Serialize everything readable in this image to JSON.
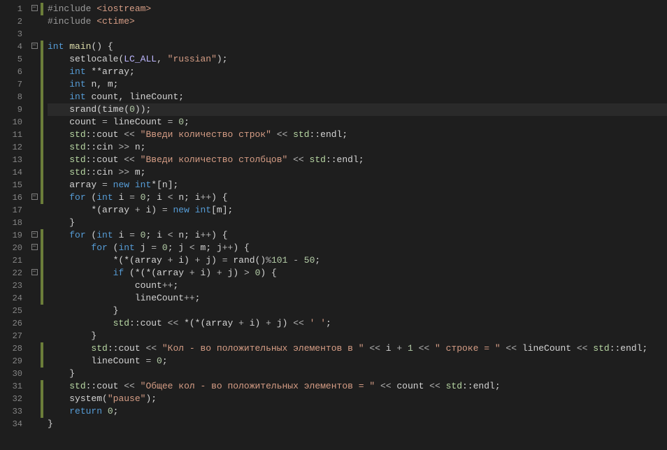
{
  "lineCount": 34,
  "foldMarkers": {
    "1": true,
    "4": true,
    "16": true,
    "19": true,
    "20": true,
    "22": true
  },
  "changedLines": [
    1,
    4,
    5,
    6,
    7,
    8,
    9,
    10,
    11,
    12,
    13,
    14,
    15,
    16,
    19,
    20,
    21,
    22,
    23,
    24,
    28,
    29,
    31,
    32,
    33
  ],
  "currentLine": 9,
  "code": [
    [
      [
        "tok-pp",
        "#include "
      ],
      [
        "tok-inc",
        "<iostream>"
      ]
    ],
    [
      [
        "tok-pp",
        "#include "
      ],
      [
        "tok-inc",
        "<ctime>"
      ]
    ],
    [],
    [
      [
        "tok-kw",
        "int"
      ],
      [
        "tok-punct",
        " "
      ],
      [
        "tok-fn",
        "main"
      ],
      [
        "tok-punct",
        "() {"
      ]
    ],
    [
      [
        "tok-punct",
        "    "
      ],
      [
        "tok-id",
        "setlocale"
      ],
      [
        "tok-punct",
        "("
      ],
      [
        "tok-macro",
        "LC_ALL"
      ],
      [
        "tok-punct",
        ", "
      ],
      [
        "tok-str",
        "\"russian\""
      ],
      [
        "tok-punct",
        ");"
      ]
    ],
    [
      [
        "tok-punct",
        "    "
      ],
      [
        "tok-kw",
        "int"
      ],
      [
        "tok-punct",
        " **"
      ],
      [
        "tok-id",
        "array"
      ],
      [
        "tok-punct",
        ";"
      ]
    ],
    [
      [
        "tok-punct",
        "    "
      ],
      [
        "tok-kw",
        "int"
      ],
      [
        "tok-punct",
        " "
      ],
      [
        "tok-id",
        "n"
      ],
      [
        "tok-punct",
        ", "
      ],
      [
        "tok-id",
        "m"
      ],
      [
        "tok-punct",
        ";"
      ]
    ],
    [
      [
        "tok-punct",
        "    "
      ],
      [
        "tok-kw",
        "int"
      ],
      [
        "tok-punct",
        " "
      ],
      [
        "tok-id",
        "count"
      ],
      [
        "tok-punct",
        ", "
      ],
      [
        "tok-id",
        "lineCount"
      ],
      [
        "tok-punct",
        ";"
      ]
    ],
    [
      [
        "tok-punct",
        "    "
      ],
      [
        "tok-id",
        "srand"
      ],
      [
        "tok-punct",
        "("
      ],
      [
        "tok-id",
        "time"
      ],
      [
        "tok-punct",
        "("
      ],
      [
        "tok-num",
        "0"
      ],
      [
        "tok-punct",
        "));"
      ]
    ],
    [
      [
        "tok-punct",
        "    "
      ],
      [
        "tok-id",
        "count"
      ],
      [
        "tok-op",
        " = "
      ],
      [
        "tok-id",
        "lineCount"
      ],
      [
        "tok-op",
        " = "
      ],
      [
        "tok-num",
        "0"
      ],
      [
        "tok-punct",
        ";"
      ]
    ],
    [
      [
        "tok-punct",
        "    "
      ],
      [
        "tok-ns",
        "std"
      ],
      [
        "tok-punct",
        "::"
      ],
      [
        "tok-id",
        "cout"
      ],
      [
        "tok-op",
        " << "
      ],
      [
        "tok-str",
        "\"Введи количество строк\""
      ],
      [
        "tok-op",
        " << "
      ],
      [
        "tok-ns",
        "std"
      ],
      [
        "tok-punct",
        "::"
      ],
      [
        "tok-id",
        "endl"
      ],
      [
        "tok-punct",
        ";"
      ]
    ],
    [
      [
        "tok-punct",
        "    "
      ],
      [
        "tok-ns",
        "std"
      ],
      [
        "tok-punct",
        "::"
      ],
      [
        "tok-id",
        "cin"
      ],
      [
        "tok-op",
        " >> "
      ],
      [
        "tok-id",
        "n"
      ],
      [
        "tok-punct",
        ";"
      ]
    ],
    [
      [
        "tok-punct",
        "    "
      ],
      [
        "tok-ns",
        "std"
      ],
      [
        "tok-punct",
        "::"
      ],
      [
        "tok-id",
        "cout"
      ],
      [
        "tok-op",
        " << "
      ],
      [
        "tok-str",
        "\"Введи количество столбцов\""
      ],
      [
        "tok-op",
        " << "
      ],
      [
        "tok-ns",
        "std"
      ],
      [
        "tok-punct",
        "::"
      ],
      [
        "tok-id",
        "endl"
      ],
      [
        "tok-punct",
        ";"
      ]
    ],
    [
      [
        "tok-punct",
        "    "
      ],
      [
        "tok-ns",
        "std"
      ],
      [
        "tok-punct",
        "::"
      ],
      [
        "tok-id",
        "cin"
      ],
      [
        "tok-op",
        " >> "
      ],
      [
        "tok-id",
        "m"
      ],
      [
        "tok-punct",
        ";"
      ]
    ],
    [
      [
        "tok-punct",
        "    "
      ],
      [
        "tok-id",
        "array"
      ],
      [
        "tok-op",
        " = "
      ],
      [
        "tok-kw",
        "new"
      ],
      [
        "tok-punct",
        " "
      ],
      [
        "tok-kw",
        "int"
      ],
      [
        "tok-punct",
        "*["
      ],
      [
        "tok-id",
        "n"
      ],
      [
        "tok-punct",
        "];"
      ]
    ],
    [
      [
        "tok-punct",
        "    "
      ],
      [
        "tok-kw",
        "for"
      ],
      [
        "tok-punct",
        " ("
      ],
      [
        "tok-kw",
        "int"
      ],
      [
        "tok-punct",
        " "
      ],
      [
        "tok-id",
        "i"
      ],
      [
        "tok-op",
        " = "
      ],
      [
        "tok-num",
        "0"
      ],
      [
        "tok-punct",
        "; "
      ],
      [
        "tok-id",
        "i"
      ],
      [
        "tok-op",
        " < "
      ],
      [
        "tok-id",
        "n"
      ],
      [
        "tok-punct",
        "; "
      ],
      [
        "tok-id",
        "i"
      ],
      [
        "tok-op",
        "++"
      ],
      [
        "tok-punct",
        ") {"
      ]
    ],
    [
      [
        "tok-punct",
        "        *("
      ],
      [
        "tok-id",
        "array"
      ],
      [
        "tok-op",
        " + "
      ],
      [
        "tok-id",
        "i"
      ],
      [
        "tok-punct",
        ") "
      ],
      [
        "tok-op",
        "="
      ],
      [
        "tok-punct",
        " "
      ],
      [
        "tok-kw",
        "new"
      ],
      [
        "tok-punct",
        " "
      ],
      [
        "tok-kw",
        "int"
      ],
      [
        "tok-punct",
        "["
      ],
      [
        "tok-id",
        "m"
      ],
      [
        "tok-punct",
        "];"
      ]
    ],
    [
      [
        "tok-punct",
        "    }"
      ]
    ],
    [
      [
        "tok-punct",
        "    "
      ],
      [
        "tok-kw",
        "for"
      ],
      [
        "tok-punct",
        " ("
      ],
      [
        "tok-kw",
        "int"
      ],
      [
        "tok-punct",
        " "
      ],
      [
        "tok-id",
        "i"
      ],
      [
        "tok-op",
        " = "
      ],
      [
        "tok-num",
        "0"
      ],
      [
        "tok-punct",
        "; "
      ],
      [
        "tok-id",
        "i"
      ],
      [
        "tok-op",
        " < "
      ],
      [
        "tok-id",
        "n"
      ],
      [
        "tok-punct",
        "; "
      ],
      [
        "tok-id",
        "i"
      ],
      [
        "tok-op",
        "++"
      ],
      [
        "tok-punct",
        ") {"
      ]
    ],
    [
      [
        "tok-punct",
        "        "
      ],
      [
        "tok-kw",
        "for"
      ],
      [
        "tok-punct",
        " ("
      ],
      [
        "tok-kw",
        "int"
      ],
      [
        "tok-punct",
        " "
      ],
      [
        "tok-id",
        "j"
      ],
      [
        "tok-op",
        " = "
      ],
      [
        "tok-num",
        "0"
      ],
      [
        "tok-punct",
        "; "
      ],
      [
        "tok-id",
        "j"
      ],
      [
        "tok-op",
        " < "
      ],
      [
        "tok-id",
        "m"
      ],
      [
        "tok-punct",
        "; "
      ],
      [
        "tok-id",
        "j"
      ],
      [
        "tok-op",
        "++"
      ],
      [
        "tok-punct",
        ") {"
      ]
    ],
    [
      [
        "tok-punct",
        "            *(*("
      ],
      [
        "tok-id",
        "array"
      ],
      [
        "tok-op",
        " + "
      ],
      [
        "tok-id",
        "i"
      ],
      [
        "tok-punct",
        ") "
      ],
      [
        "tok-op",
        "+"
      ],
      [
        "tok-punct",
        " "
      ],
      [
        "tok-id",
        "j"
      ],
      [
        "tok-punct",
        ") "
      ],
      [
        "tok-op",
        "="
      ],
      [
        "tok-punct",
        " "
      ],
      [
        "tok-id",
        "rand"
      ],
      [
        "tok-punct",
        "()"
      ],
      [
        "tok-op",
        "%"
      ],
      [
        "tok-num",
        "101"
      ],
      [
        "tok-op",
        " - "
      ],
      [
        "tok-num",
        "50"
      ],
      [
        "tok-punct",
        ";"
      ]
    ],
    [
      [
        "tok-punct",
        "            "
      ],
      [
        "tok-kw",
        "if"
      ],
      [
        "tok-punct",
        " (*(*("
      ],
      [
        "tok-id",
        "array"
      ],
      [
        "tok-op",
        " + "
      ],
      [
        "tok-id",
        "i"
      ],
      [
        "tok-punct",
        ") "
      ],
      [
        "tok-op",
        "+"
      ],
      [
        "tok-punct",
        " "
      ],
      [
        "tok-id",
        "j"
      ],
      [
        "tok-punct",
        ") "
      ],
      [
        "tok-op",
        ">"
      ],
      [
        "tok-punct",
        " "
      ],
      [
        "tok-num",
        "0"
      ],
      [
        "tok-punct",
        ") {"
      ]
    ],
    [
      [
        "tok-punct",
        "                "
      ],
      [
        "tok-id",
        "count"
      ],
      [
        "tok-op",
        "++"
      ],
      [
        "tok-punct",
        ";"
      ]
    ],
    [
      [
        "tok-punct",
        "                "
      ],
      [
        "tok-id",
        "lineCount"
      ],
      [
        "tok-op",
        "++"
      ],
      [
        "tok-punct",
        ";"
      ]
    ],
    [
      [
        "tok-punct",
        "            }"
      ]
    ],
    [
      [
        "tok-punct",
        "            "
      ],
      [
        "tok-ns",
        "std"
      ],
      [
        "tok-punct",
        "::"
      ],
      [
        "tok-id",
        "cout"
      ],
      [
        "tok-op",
        " << "
      ],
      [
        "tok-punct",
        "*(*("
      ],
      [
        "tok-id",
        "array"
      ],
      [
        "tok-op",
        " + "
      ],
      [
        "tok-id",
        "i"
      ],
      [
        "tok-punct",
        ") "
      ],
      [
        "tok-op",
        "+"
      ],
      [
        "tok-punct",
        " "
      ],
      [
        "tok-id",
        "j"
      ],
      [
        "tok-punct",
        ") "
      ],
      [
        "tok-op",
        "<<"
      ],
      [
        "tok-punct",
        " "
      ],
      [
        "tok-str",
        "' '"
      ],
      [
        "tok-punct",
        ";"
      ]
    ],
    [
      [
        "tok-punct",
        "        }"
      ]
    ],
    [
      [
        "tok-punct",
        "        "
      ],
      [
        "tok-ns",
        "std"
      ],
      [
        "tok-punct",
        "::"
      ],
      [
        "tok-id",
        "cout"
      ],
      [
        "tok-op",
        " << "
      ],
      [
        "tok-str",
        "\"Кол - во положительных элементов в \""
      ],
      [
        "tok-op",
        " << "
      ],
      [
        "tok-id",
        "i"
      ],
      [
        "tok-op",
        " + "
      ],
      [
        "tok-num",
        "1"
      ],
      [
        "tok-op",
        " << "
      ],
      [
        "tok-str",
        "\" строке = \""
      ],
      [
        "tok-op",
        " << "
      ],
      [
        "tok-id",
        "lineCount"
      ],
      [
        "tok-op",
        " << "
      ],
      [
        "tok-ns",
        "std"
      ],
      [
        "tok-punct",
        "::"
      ],
      [
        "tok-id",
        "endl"
      ],
      [
        "tok-punct",
        ";"
      ]
    ],
    [
      [
        "tok-punct",
        "        "
      ],
      [
        "tok-id",
        "lineCount"
      ],
      [
        "tok-op",
        " = "
      ],
      [
        "tok-num",
        "0"
      ],
      [
        "tok-punct",
        ";"
      ]
    ],
    [
      [
        "tok-punct",
        "    }"
      ]
    ],
    [
      [
        "tok-punct",
        "    "
      ],
      [
        "tok-ns",
        "std"
      ],
      [
        "tok-punct",
        "::"
      ],
      [
        "tok-id",
        "cout"
      ],
      [
        "tok-op",
        " << "
      ],
      [
        "tok-str",
        "\"Общее кол - во положительных элементов = \""
      ],
      [
        "tok-op",
        " << "
      ],
      [
        "tok-id",
        "count"
      ],
      [
        "tok-op",
        " << "
      ],
      [
        "tok-ns",
        "std"
      ],
      [
        "tok-punct",
        "::"
      ],
      [
        "tok-id",
        "endl"
      ],
      [
        "tok-punct",
        ";"
      ]
    ],
    [
      [
        "tok-punct",
        "    "
      ],
      [
        "tok-id",
        "system"
      ],
      [
        "tok-punct",
        "("
      ],
      [
        "tok-str",
        "\"pause\""
      ],
      [
        "tok-punct",
        ");"
      ]
    ],
    [
      [
        "tok-punct",
        "    "
      ],
      [
        "tok-kw",
        "return"
      ],
      [
        "tok-punct",
        " "
      ],
      [
        "tok-num",
        "0"
      ],
      [
        "tok-punct",
        ";"
      ]
    ],
    [
      [
        "tok-punct",
        "}"
      ]
    ]
  ]
}
